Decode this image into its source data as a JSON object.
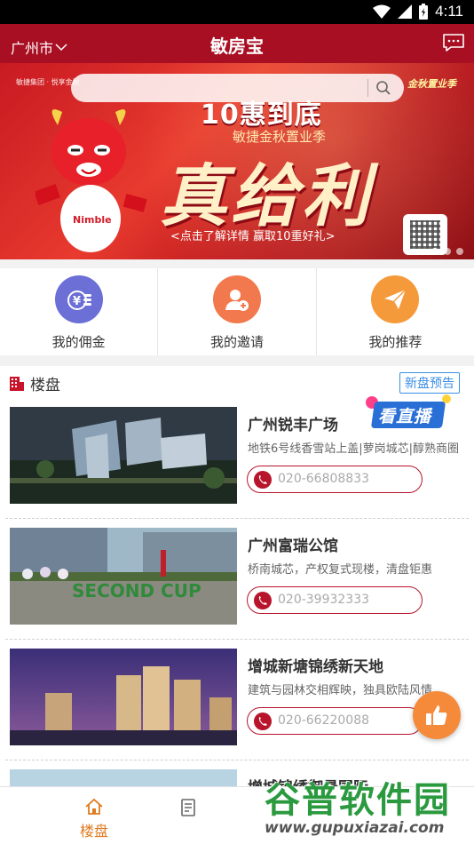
{
  "status_bar": {
    "time": "4:11"
  },
  "header": {
    "city": "广州市",
    "title": "敏房宝"
  },
  "banner": {
    "search_placeholder": "",
    "brand_left": "敏捷集团 · 悦享金秋",
    "brand_right": "金秋置业季",
    "headline": "10惠到底",
    "subtitle": "敏捷金秋置业季",
    "big_text": "真给利",
    "cta": "<点击了解详情 赢取10重好礼>",
    "slides": 3,
    "active_slide": 1
  },
  "quick_menu": [
    {
      "label": "我的佣金",
      "icon": "coin-icon",
      "color": "#6b6fd6"
    },
    {
      "label": "我的邀请",
      "icon": "add-user-icon",
      "color": "#f2794d"
    },
    {
      "label": "我的推荐",
      "icon": "paper-plane-icon",
      "color": "#f59a3a"
    }
  ],
  "listing_section": {
    "title": "楼盘",
    "new_preview": "新盘预告",
    "live_label": "看直播"
  },
  "listings": [
    {
      "name": "广州锐丰广场",
      "desc": "地铁6号线香雪站上盖|萝岗城芯|醇熟商圈",
      "phone": "020-66808833"
    },
    {
      "name": "广州富瑞公馆",
      "desc": "桥南城芯，产权复式现楼，清盘钜惠",
      "phone": "020-39932333"
    },
    {
      "name": "增城新塘锦绣新天地",
      "desc": "建筑与园林交相辉映，独具欧陆风情",
      "phone": "020-66220088"
    },
    {
      "name": "增城锦绣御景国际",
      "desc": "",
      "phone": ""
    }
  ],
  "bottom_nav": [
    {
      "label": "楼盘",
      "active": true
    },
    {
      "label": "",
      "active": false
    }
  ],
  "watermark": {
    "main": "谷普软件园",
    "url": "www.gupuxiazai.com"
  },
  "colors": {
    "brand": "#a80f23",
    "active_nav": "#e07a1f",
    "link_blue": "#3a8ee6"
  }
}
